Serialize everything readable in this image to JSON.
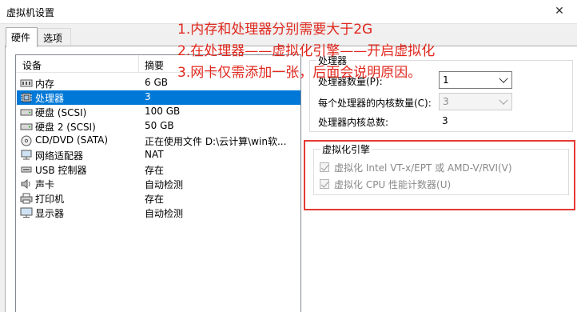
{
  "window": {
    "title": "虚拟机设置",
    "close_glyph": "✕"
  },
  "tabs": [
    {
      "label": "硬件"
    },
    {
      "label": "选项"
    }
  ],
  "device_list": {
    "headers": {
      "device": "设备",
      "summary": "摘要"
    },
    "rows": [
      {
        "name": "内存",
        "value": "6 GB",
        "icon": "memory-icon"
      },
      {
        "name": "处理器",
        "value": "3",
        "icon": "processor-icon",
        "selected": true
      },
      {
        "name": "硬盘 (SCSI)",
        "value": "100 GB",
        "icon": "hard-disk-icon"
      },
      {
        "name": "硬盘 2 (SCSI)",
        "value": "50 GB",
        "icon": "hard-disk-icon"
      },
      {
        "name": "CD/DVD (SATA)",
        "value": "正在使用文件 D:\\云计算\\win软...",
        "icon": "cd-dvd-icon"
      },
      {
        "name": "网络适配器",
        "value": "NAT",
        "icon": "network-adapter-icon"
      },
      {
        "name": "USB 控制器",
        "value": "存在",
        "icon": "usb-controller-icon"
      },
      {
        "name": "声卡",
        "value": "自动检测",
        "icon": "sound-card-icon"
      },
      {
        "name": "打印机",
        "value": "存在",
        "icon": "printer-icon"
      },
      {
        "name": "显示器",
        "value": "自动检测",
        "icon": "display-icon"
      }
    ]
  },
  "processor_group": {
    "legend": "处理器",
    "count_label": "处理器数量(P):",
    "count_value": "1",
    "cores_label": "每个处理器的内核数量(C):",
    "cores_value": "3",
    "total_label": "处理器内核总数:",
    "total_value": "3"
  },
  "virtualization_group": {
    "legend": "虚拟化引擎",
    "option1": "虚拟化 Intel VT-x/EPT 或 AMD-V/RVI(V)",
    "option2": "虚拟化 CPU 性能计数器(U)",
    "option1_checked": true,
    "option2_checked": true
  },
  "annotations": {
    "line1": "1.内存和处理器分别需要大于2G",
    "line2": "2.在处理器——虚拟化引擎——开启虚拟化",
    "line3": "3.网卡仅需添加一张，后面会说明原因。",
    "color": "#e0281e"
  },
  "colors": {
    "selection": "#0078d7",
    "highlight_box": "#e53935"
  }
}
